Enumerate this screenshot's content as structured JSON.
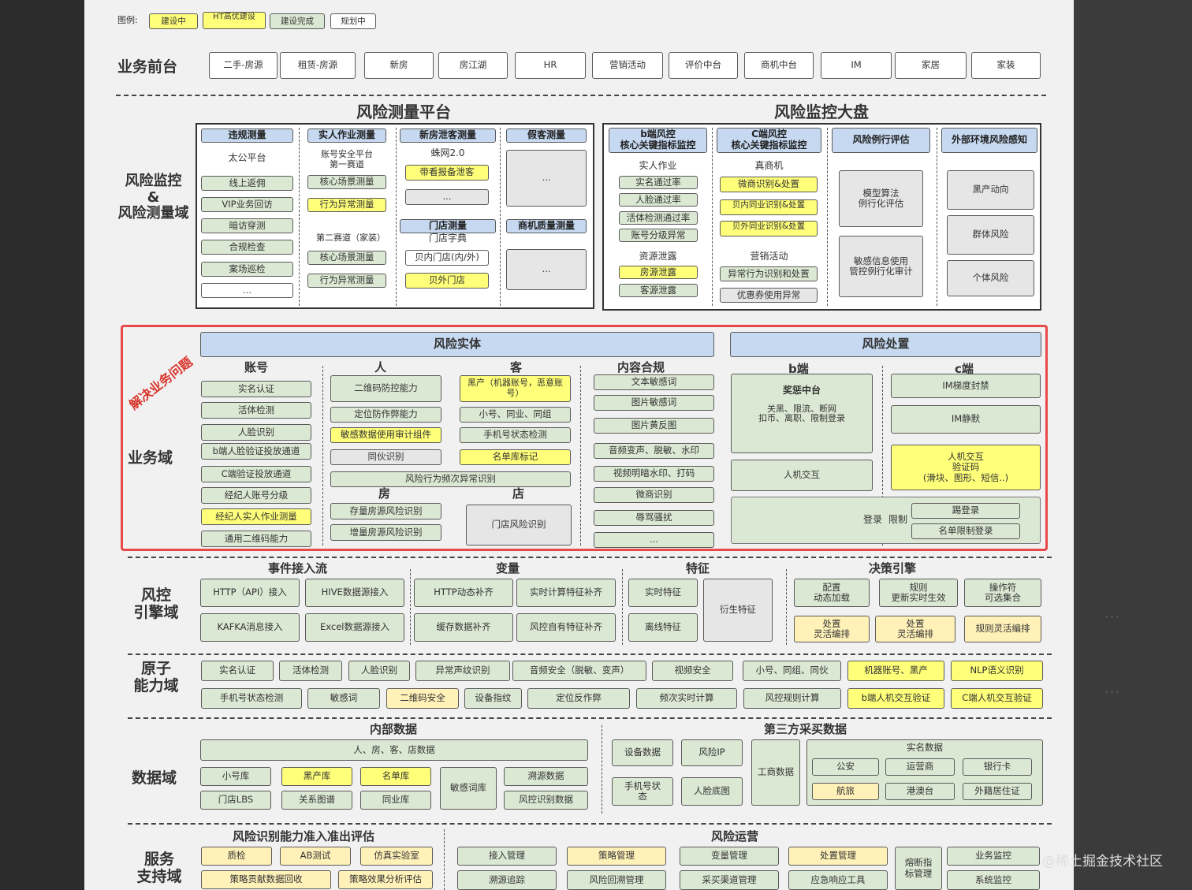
{
  "legend": {
    "label": "图例:",
    "items": [
      {
        "text": "建设中",
        "color": "#ffff7a"
      },
      {
        "text": "HT高优建设",
        "color": "#ffff7a"
      },
      {
        "text": "建设完成",
        "color": "#dbe8d3"
      },
      {
        "text": "规划中",
        "color": "#ffffff"
      }
    ]
  },
  "front": {
    "title": "业务前台",
    "items": [
      "二手-房源",
      "租赁-房源",
      "新房",
      "房江湖",
      "HR",
      "营销活动",
      "评价中台",
      "商机中台",
      "IM",
      "家居",
      "家装"
    ]
  },
  "monitor": {
    "label": "风险监控\n&\n风险测量域",
    "measure_title": "风险测量平台",
    "dash_title": "风险监控大盘",
    "c1": {
      "head": "违规测量",
      "sub": "太公平台",
      "items": [
        "线上返佣",
        "VIP业务回访",
        "暗访穿测",
        "合规检查",
        "案场巡检",
        "..."
      ]
    },
    "c2": {
      "head": "实人作业测量",
      "sub1": "账号安全平台\n第一赛道",
      "i1": "核心场景测量",
      "i2": "行为异常测量",
      "sub2": "第二赛道（家装）",
      "i3": "核心场景测量",
      "i4": "行为异常测量"
    },
    "c3": {
      "head": "新房泄客测量",
      "sub": "蛛网2.0",
      "i1": "带看报备泄客",
      "i2": "...",
      "head2": "门店测量",
      "sub2": "门店字典",
      "i3": "贝内门店(内/外)",
      "i4": "贝外门店"
    },
    "c4": {
      "head": "假客测量",
      "i1": "...",
      "head2": "商机质量测量",
      "i2": "..."
    },
    "d1": {
      "head": "b端风控\n核心关键指标监控",
      "sub": "实人作业",
      "items": [
        "实名通过率",
        "人脸通过率",
        "活体检测通过率",
        "账号分级异常"
      ],
      "sub2": "资源泄露",
      "i5": "房源泄露",
      "i6": "客源泄露"
    },
    "d2": {
      "head": "C端风控\n核心关键指标监控",
      "sub": "真商机",
      "items": [
        "微商识别&处置",
        "贝内同业识别&处置",
        "贝外同业识别&处置"
      ],
      "sub2": "营销活动",
      "i4": "异常行为识别和处置",
      "i5": "优惠券使用异常"
    },
    "d3": {
      "head": "风险例行评估",
      "i1": "模型算法\n例行化评估",
      "i2": "敏感信息使用\n管控例行化审计"
    },
    "d4": {
      "head": "外部环境风险感知",
      "items": [
        "黑产动向",
        "群体风险",
        "个体风险"
      ]
    }
  },
  "biz": {
    "label": "业务域",
    "tag": "解决业务问题",
    "entity": "风险实体",
    "dispose": "风险处置",
    "acct": {
      "title": "账号",
      "items": [
        "实名认证",
        "活体检测",
        "人脸识别",
        "b端人脸验证投放通道",
        "C端验证投放通道",
        "经纪人账号分级",
        "经纪人实人作业测量",
        "通用二维码能力"
      ]
    },
    "person": {
      "title": "人",
      "items": [
        "二维码防控能力",
        "定位防作弊能力",
        "敏感数据使用审计组件",
        "同伙识别"
      ]
    },
    "cust": {
      "title": "客",
      "items": [
        "黑产（机器账号，恶意账号）",
        "小号、同业、同组",
        "手机号状态检测",
        "名单库标记"
      ]
    },
    "shared": "风险行为频次异常识别",
    "house": {
      "title": "房",
      "items": [
        "存量房源风险识别",
        "增量房源风险识别"
      ]
    },
    "store": {
      "title": "店",
      "item": "门店风险识别"
    },
    "content": {
      "title": "内容合规",
      "items": [
        "文本敏感词",
        "图片敏感词",
        "图片黄反图",
        "音频变声、脱敏、水印",
        "视频明暗水印、打码",
        "微商识别",
        "辱骂骚扰",
        "..."
      ]
    },
    "bside": {
      "title": "b端",
      "center": "奖惩中台",
      "centertext": "关黑、限流、断网\n扣币、离职、限制登录",
      "human": "人机交互"
    },
    "cside": {
      "title": "c端",
      "i1": "IM梯度封禁",
      "i2": "IM静默",
      "i3": "人机交互\n验证码\n(滑块、图形、短信..)",
      "login": "登录",
      "limit": "限制",
      "kick": "踢登录",
      "list": "名单限制登录"
    }
  },
  "engine": {
    "label": "风控\n引擎域",
    "h1": "事件接入流",
    "h2": "变量",
    "h3": "特征",
    "h4": "决策引擎",
    "e": [
      "HTTP（API）接入",
      "HIVE数据源接入",
      "KAFKA消息接入",
      "Excel数据源接入"
    ],
    "v": [
      "HTTP动态补齐",
      "实时计算特征补齐",
      "缓存数据补齐",
      "风控自有特征补齐"
    ],
    "f": [
      "实时特征",
      "离线特征",
      "衍生特征"
    ],
    "d": [
      "配置\n动态加载",
      "规则\n更新实时生效",
      "操作符\n可选集合",
      "处置\n灵活编排",
      "处置\n灵活编排",
      "规则灵活编排"
    ]
  },
  "atom": {
    "label": "原子\n能力域",
    "r1": [
      "实名认证",
      "活体检测",
      "人脸识别",
      "异常声纹识别",
      "音频安全（脱敏、变声）",
      "视频安全",
      "小号、同组、同伙",
      "机器账号、黑产",
      "NLP语义识别"
    ],
    "r2": [
      "手机号状态检测",
      "敏感词",
      "二维码安全",
      "设备指纹",
      "定位反作弊",
      "频次实时计算",
      "风控规则计算",
      "b端人机交互验证",
      "C端人机交互验证"
    ]
  },
  "data": {
    "label": "数据域",
    "inner": "内部数据",
    "third": "第三方采买数据",
    "wide": "人、房、客、店数据",
    "i": [
      "小号库",
      "黑产库",
      "名单库",
      "门店LBS",
      "关系图谱",
      "同业库",
      "敏感词库",
      "溯源数据",
      "风控识别数据"
    ],
    "t": [
      "设备数据",
      "风险IP",
      "手机号状\n态",
      "人脸底图",
      "工商数据"
    ],
    "real": "实名数据",
    "rs": [
      "公安",
      "运营商",
      "银行卡",
      "航旅",
      "港澳台",
      "外籍居住证"
    ]
  },
  "svc": {
    "label": "服务\n支持域",
    "h1": "风险识别能力准入准出评估",
    "h2": "风险运营",
    "l": [
      "质检",
      "AB测试",
      "仿真实验室",
      "策略贡献数据回收",
      "策略效果分析评估"
    ],
    "r": [
      "接入管理",
      "策略管理",
      "变量管理",
      "处置管理",
      "熔断指\n标管理",
      "业务监控",
      "溯源追踪",
      "风险回溯管理",
      "采买渠道管理",
      "应急响应工具",
      "系统监控"
    ]
  },
  "watermark": "@稀土掘金技术社区",
  "ghosts": [
    "...",
    "..."
  ]
}
